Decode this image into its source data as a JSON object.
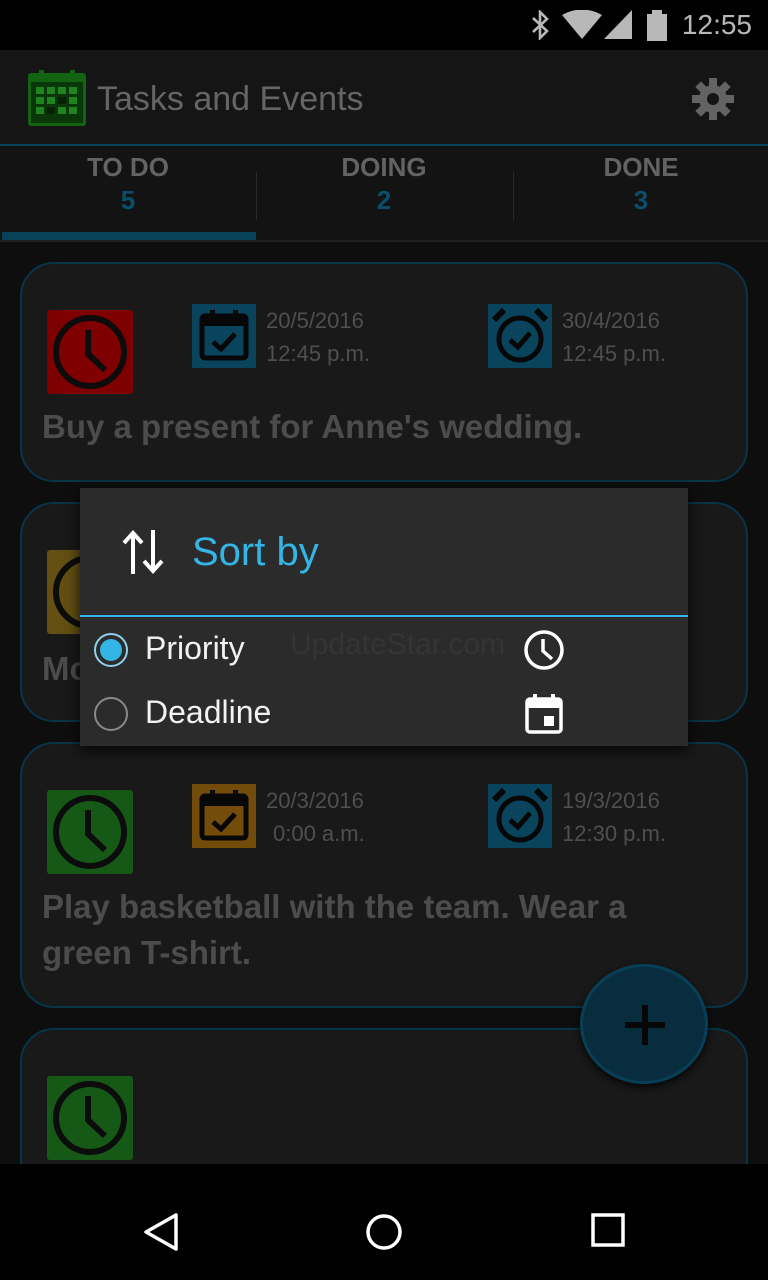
{
  "status_bar": {
    "time": "12:55",
    "icons": [
      "bluetooth-icon",
      "wifi-icon",
      "signal-icon",
      "battery-icon"
    ]
  },
  "app_bar": {
    "title": "Tasks and Events",
    "settings_icon": "gear-icon"
  },
  "tabs": [
    {
      "label": "TO DO",
      "count": "5",
      "selected": true
    },
    {
      "label": "DOING",
      "count": "2",
      "selected": false
    },
    {
      "label": "DONE",
      "count": "3",
      "selected": false
    }
  ],
  "tasks": [
    {
      "priority_color": "#b00000",
      "deadline_icon_color": "#0d5f80",
      "deadline_date": "20/5/2016",
      "deadline_time": "12:45 p.m.",
      "alarm_icon_color": "#0d5f80",
      "alarm_date": "30/4/2016",
      "alarm_time": "12:45 p.m.",
      "title": "Buy a present for Anne's wedding."
    },
    {
      "priority_color": "#8a6f1a",
      "title": "Mo"
    },
    {
      "priority_color": "#1f7a1f",
      "deadline_icon_color": "#a06a10",
      "deadline_date": "20/3/2016",
      "deadline_time": "0:00 a.m.",
      "alarm_icon_color": "#0d5f80",
      "alarm_date": "19/3/2016",
      "alarm_time": "12:30 p.m.",
      "title_line1": "Play basketball with the team. Wear a",
      "title_line2": "green T-shirt."
    },
    {
      "priority_color": "#1f7a1f"
    }
  ],
  "fab": {
    "icon": "plus-icon"
  },
  "sort_dialog": {
    "title": "Sort by",
    "icon": "sort-arrows-icon",
    "watermark": "UpdateStar.com",
    "options": [
      {
        "label": "Priority",
        "checked": true,
        "icon": "clock-icon"
      },
      {
        "label": "Deadline",
        "checked": false,
        "icon": "calendar-icon"
      }
    ]
  },
  "nav_bar": {
    "icons": [
      "back-icon",
      "home-icon",
      "recents-icon"
    ]
  },
  "colors": {
    "accent": "#33b5e5",
    "tab_count": "#0d6e93",
    "card_border": "#0a4a64"
  }
}
